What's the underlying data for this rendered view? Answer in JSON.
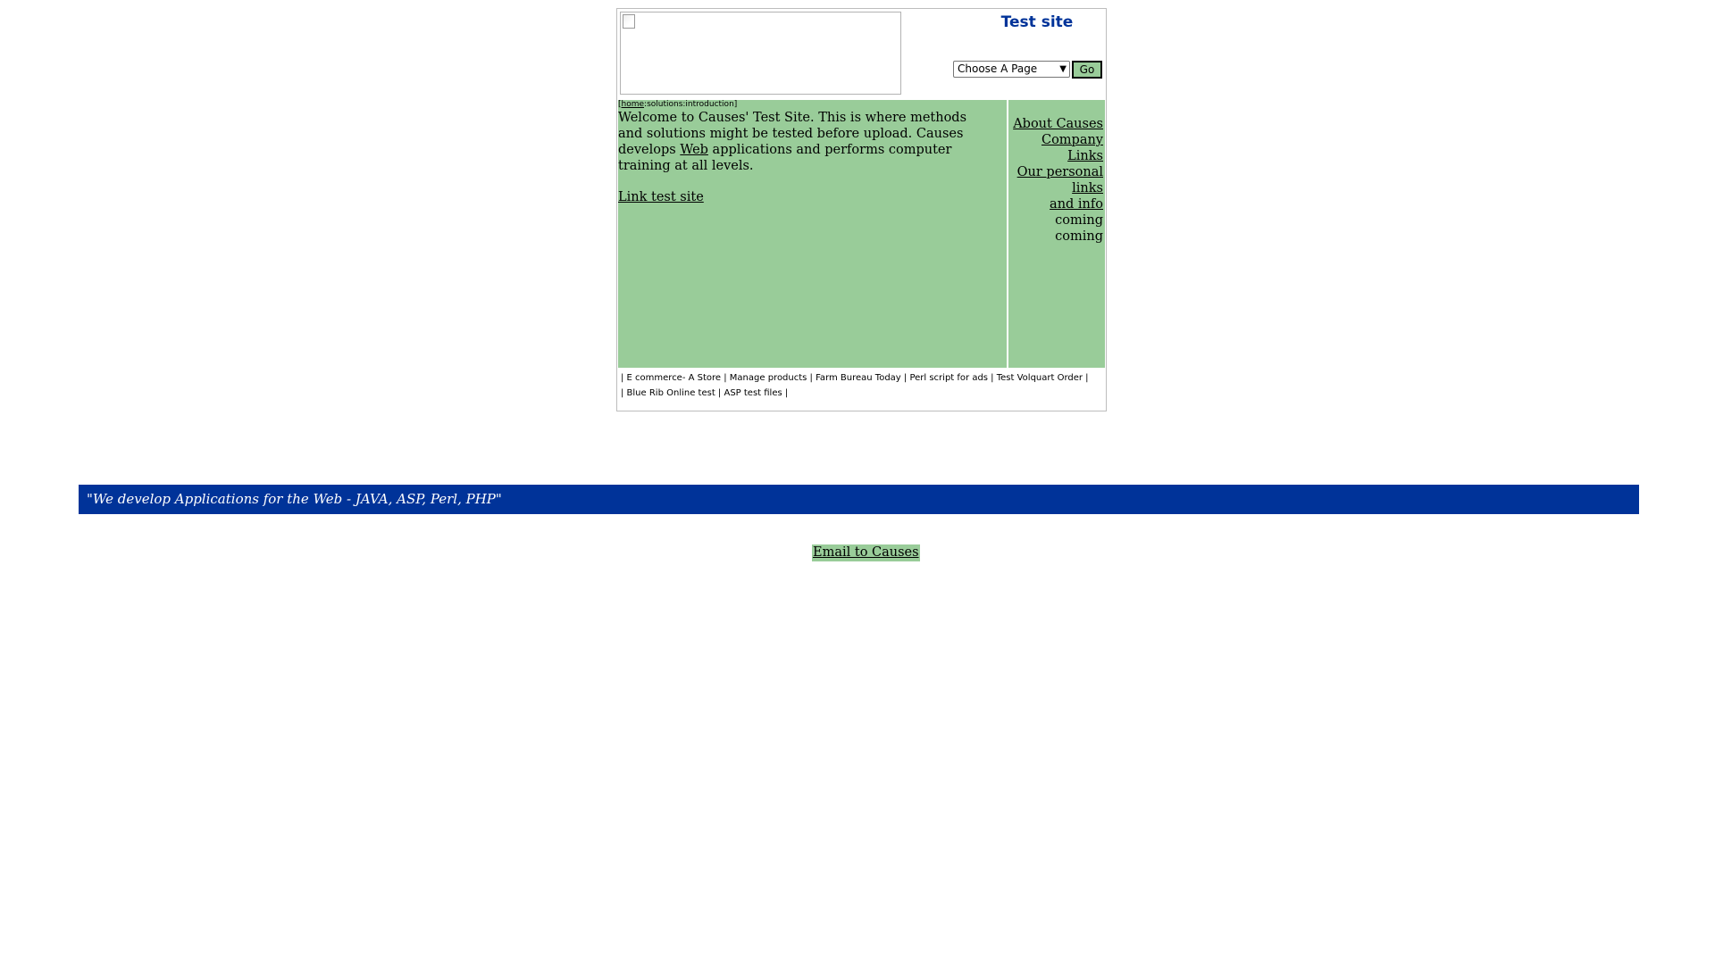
{
  "header": {
    "site_title": "Test site",
    "page_select": {
      "selected": "Choose A Page",
      "options": [
        "Choose A Page"
      ]
    },
    "go_label": "Go"
  },
  "breadcrumb": {
    "open": "[",
    "home": "home",
    "path": ":solutions:introduction]"
  },
  "content": {
    "welcome_before": "Welcome to Causes' Test Site. This is where methods and solutions might be tested before upload. Causes develops ",
    "web_link": "Web",
    "welcome_after": " applications and performs computer training at all levels.",
    "link_test_site": "Link test site"
  },
  "sidebar": {
    "about": "About Causes",
    "company": "Company",
    "links": "Links",
    "personal": "Our personal",
    "personal2": "links",
    "info": "and info",
    "coming1": "coming",
    "coming2": "coming"
  },
  "footer_links": {
    "row1": "| E commerce- A Store | Manage products | Farm Bureau Today | Perl script for ads | Test Volquart Order |",
    "row2": "| Blue Rib Online test | ASP test files |"
  },
  "tagline": "\"We develop Applications for the Web - JAVA, ASP, Perl, PHP\"",
  "email_link": "Email to Causes",
  "colors": {
    "green": "#99cc99",
    "blue": "#003399"
  }
}
